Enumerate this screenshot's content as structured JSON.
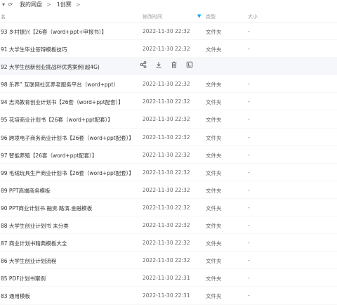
{
  "topbar": {
    "back_icon": "chevron-down-icon",
    "refresh_icon": "refresh-icon",
    "breadcrumb": [
      "我的网盘",
      "1创赛"
    ],
    "separator": ">"
  },
  "header": {
    "name": "名",
    "modified": "修改时间",
    "type": "类型",
    "size": "大小"
  },
  "rows": [
    {
      "name": "93 乡村振兴【26套（word+ppt+申报书）】",
      "time": "2022-11-30 22:32",
      "type": "文件夹",
      "size": "-"
    },
    {
      "name": "91 大学生毕业答辩模板技巧",
      "time": "2022-11-30 22:32",
      "type": "文件夹",
      "size": "-"
    },
    {
      "name": "92 大学生创新创业挑战杯优秀案例(超4G)",
      "time": "",
      "type": "",
      "size": ""
    },
    {
      "name": "98 乐养” 互联网社区养老服务平台（word+ppt）",
      "time": "2022-11-30 22:32",
      "type": "文件夹",
      "size": "-"
    },
    {
      "name": "94 志鸿教育创业计划书【26套（word+ppt配套）】",
      "time": "2022-11-30 22:32",
      "type": "文件夹",
      "size": "-"
    },
    {
      "name": "95 花培商业计划书【26套（word+ppt配套）】",
      "time": "2022-11-30 22:32",
      "type": "文件夹",
      "size": "-"
    },
    {
      "name": "96 跨境电子商务商业计划书【26套（word+ppt配套）】",
      "time": "2022-11-30 22:32",
      "type": "文件夹",
      "size": "-"
    },
    {
      "name": "97 智能养殖【26套（word+ppt配套）】",
      "time": "2022-11-30 22:32",
      "type": "文件夹",
      "size": "-"
    },
    {
      "name": "99 毛绒玩具生产商业计划书【26套（word+ppt配套）】",
      "time": "2022-11-30 22:32",
      "type": "文件夹",
      "size": "-"
    },
    {
      "name": "89 PPT高端商务模板",
      "time": "2022-11-30 22:32",
      "type": "文件夹",
      "size": "-"
    },
    {
      "name": "90 PPT商业计划书.融资.路演.金融模板",
      "time": "2022-11-30 22:32",
      "type": "文件夹",
      "size": "-"
    },
    {
      "name": "88 大学生创业计划书 未分类",
      "time": "2022-11-30 22:32",
      "type": "文件夹",
      "size": "-"
    },
    {
      "name": "87 商业计划书精典模板大全",
      "time": "2022-11-30 22:32",
      "type": "文件夹",
      "size": "-"
    },
    {
      "name": "86 大学生创业计划流程",
      "time": "2022-11-30 22:32",
      "type": "文件夹",
      "size": "-"
    },
    {
      "name": "85 PDF计划书案例",
      "time": "2022-11-30 22:31",
      "type": "文件夹",
      "size": "-"
    },
    {
      "name": "83 通用模板",
      "time": "2022-11-30 22:31",
      "type": "文件夹",
      "size": "-"
    }
  ],
  "hover_row_actions": [
    "share-icon",
    "download-icon",
    "delete-icon",
    "more-icon"
  ],
  "colors": {
    "accent": "#06a7ff",
    "hover_bg": "#f5f7fa"
  }
}
